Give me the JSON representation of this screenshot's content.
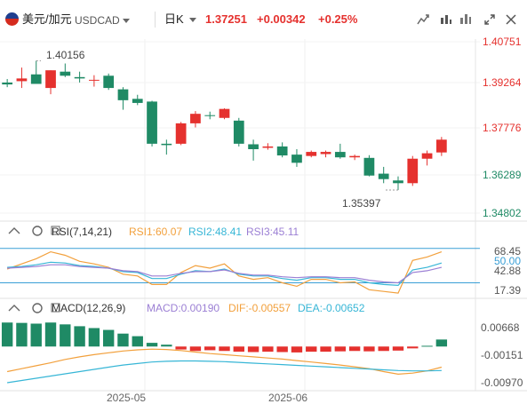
{
  "toolbar": {
    "pair_label": "美元/加元",
    "symbol": "USDCAD",
    "period": "日K",
    "last_price": "1.37251",
    "change": "+0.00342",
    "change_pct": "+0.25%",
    "icons": [
      "flag-us-icon",
      "chevron-down-icon",
      "chevron-down-icon",
      "candle-style-icon",
      "indicator-icon",
      "settings-icon",
      "fullscreen-icon",
      "close-icon"
    ]
  },
  "colors": {
    "up": "#e5312e",
    "down": "#1f8a65",
    "rsi1": "#f2a03c",
    "rsi2": "#37b6d6",
    "rsi3": "#9b7fd4",
    "diff": "#f2a03c",
    "dea": "#37b6d6"
  },
  "chart_data": [
    {
      "type": "candlestick",
      "panel": "price",
      "price_axis_ticks": [
        "1.40751",
        "1.39264",
        "1.37776",
        "1.36289",
        "1.34802"
      ],
      "ylim": [
        1.3455,
        1.4085
      ],
      "high_label": "1.40156",
      "low_label": "1.35397",
      "x_labels": [
        "2025-05",
        "2025-06"
      ],
      "candles": [
        {
          "o": 1.3935,
          "h": 1.3948,
          "l": 1.3918,
          "c": 1.3928
        },
        {
          "o": 1.394,
          "h": 1.399,
          "l": 1.3915,
          "c": 1.395
        },
        {
          "o": 1.3965,
          "h": 1.4015,
          "l": 1.395,
          "c": 1.393
        },
        {
          "o": 1.3915,
          "h": 1.398,
          "l": 1.3892,
          "c": 1.398
        },
        {
          "o": 1.3975,
          "h": 1.4005,
          "l": 1.3955,
          "c": 1.396
        },
        {
          "o": 1.3955,
          "h": 1.3975,
          "l": 1.3935,
          "c": 1.395
        },
        {
          "o": 1.3945,
          "h": 1.3962,
          "l": 1.392,
          "c": 1.3945
        },
        {
          "o": 1.396,
          "h": 1.3968,
          "l": 1.3908,
          "c": 1.3915
        },
        {
          "o": 1.391,
          "h": 1.3918,
          "l": 1.3835,
          "c": 1.387
        },
        {
          "o": 1.3875,
          "h": 1.389,
          "l": 1.3852,
          "c": 1.386
        },
        {
          "o": 1.3865,
          "h": 1.3868,
          "l": 1.37,
          "c": 1.371
        },
        {
          "o": 1.371,
          "h": 1.3725,
          "l": 1.367,
          "c": 1.3705
        },
        {
          "o": 1.371,
          "h": 1.379,
          "l": 1.3705,
          "c": 1.3785
        },
        {
          "o": 1.3785,
          "h": 1.383,
          "l": 1.377,
          "c": 1.382
        },
        {
          "o": 1.3815,
          "h": 1.3828,
          "l": 1.38,
          "c": 1.3812
        },
        {
          "o": 1.3805,
          "h": 1.384,
          "l": 1.38,
          "c": 1.3838
        },
        {
          "o": 1.3795,
          "h": 1.3805,
          "l": 1.37,
          "c": 1.371
        },
        {
          "o": 1.3708,
          "h": 1.3725,
          "l": 1.3648,
          "c": 1.369
        },
        {
          "o": 1.3695,
          "h": 1.3712,
          "l": 1.3688,
          "c": 1.37
        },
        {
          "o": 1.37,
          "h": 1.3715,
          "l": 1.366,
          "c": 1.3667
        },
        {
          "o": 1.367,
          "h": 1.369,
          "l": 1.3625,
          "c": 1.364
        },
        {
          "o": 1.3665,
          "h": 1.3685,
          "l": 1.366,
          "c": 1.368
        },
        {
          "o": 1.3672,
          "h": 1.3685,
          "l": 1.366,
          "c": 1.368
        },
        {
          "o": 1.368,
          "h": 1.371,
          "l": 1.3655,
          "c": 1.366
        },
        {
          "o": 1.366,
          "h": 1.367,
          "l": 1.365,
          "c": 1.3665
        },
        {
          "o": 1.3658,
          "h": 1.3668,
          "l": 1.359,
          "c": 1.3593
        },
        {
          "o": 1.36,
          "h": 1.3625,
          "l": 1.3565,
          "c": 1.358
        },
        {
          "o": 1.3575,
          "h": 1.359,
          "l": 1.354,
          "c": 1.3565
        },
        {
          "o": 1.3565,
          "h": 1.3665,
          "l": 1.3555,
          "c": 1.3655
        },
        {
          "o": 1.3655,
          "h": 1.3685,
          "l": 1.363,
          "c": 1.3675
        },
        {
          "o": 1.3678,
          "h": 1.3735,
          "l": 1.3665,
          "c": 1.3725
        }
      ]
    },
    {
      "type": "line",
      "panel": "rsi",
      "indicator_label": "RSI(7,14,21)",
      "legend": {
        "rsi1": "RSI1:60.07",
        "rsi2": "RSI2:48.41",
        "rsi3": "RSI3:45.11"
      },
      "axis_ticks": [
        "68.45",
        "50.00",
        "42.88",
        "17.39"
      ],
      "ref_levels": {
        "high": "70.00",
        "low": "30.00"
      },
      "ylim": [
        14,
        78
      ],
      "series": [
        {
          "name": "RSI1",
          "color_key": "rsi1",
          "values": [
            46,
            52,
            58,
            66,
            62,
            55,
            52,
            48,
            40,
            38,
            28,
            28,
            42,
            50,
            47,
            52,
            38,
            34,
            36,
            30,
            26,
            34,
            34,
            30,
            31,
            22,
            20,
            18,
            56,
            60,
            66
          ]
        },
        {
          "name": "RSI2",
          "color_key": "rsi2",
          "values": [
            48,
            49,
            51,
            54,
            53,
            50,
            49,
            47,
            43,
            42,
            35,
            35,
            40,
            44,
            43,
            46,
            40,
            38,
            38,
            35,
            33,
            36,
            36,
            34,
            34,
            30,
            28,
            27,
            45,
            48,
            53
          ]
        },
        {
          "name": "RSI3",
          "color_key": "rsi3",
          "values": [
            47,
            48,
            49,
            51,
            51,
            49,
            48,
            47,
            44,
            43,
            38,
            38,
            41,
            43,
            43,
            45,
            41,
            39,
            39,
            37,
            36,
            37,
            37,
            36,
            36,
            33,
            31,
            30,
            42,
            44,
            48
          ]
        }
      ]
    },
    {
      "type": "bar+line",
      "panel": "macd",
      "indicator_label": "MACD(12,26,9)",
      "legend": {
        "macd": "MACD:0.00190",
        "diff": "DIF:-0.00557",
        "dea": "DEA:-0.00652"
      },
      "axis_ticks": [
        "0.00668",
        "-0.00151",
        "-0.00970"
      ],
      "ylim": [
        -0.011,
        0.008
      ],
      "macd": [
        0.0065,
        0.0064,
        0.0062,
        0.0065,
        0.006,
        0.0055,
        0.005,
        0.0045,
        0.0035,
        0.0028,
        0.001,
        0.0005,
        -0.0008,
        -0.0012,
        -0.001,
        -0.0012,
        -0.0014,
        -0.0015,
        -0.0014,
        -0.0015,
        -0.0016,
        -0.0014,
        -0.0014,
        -0.0013,
        -0.0012,
        -0.0013,
        -0.0012,
        -0.0011,
        -0.0005,
        0.0002,
        0.0019
      ],
      "dif": [
        -0.0068,
        -0.006,
        -0.0052,
        -0.0044,
        -0.0035,
        -0.0028,
        -0.0022,
        -0.0017,
        -0.0012,
        -0.0009,
        -0.0007,
        -0.0008,
        -0.0011,
        -0.0015,
        -0.0019,
        -0.0022,
        -0.0025,
        -0.0028,
        -0.0031,
        -0.0034,
        -0.0038,
        -0.0042,
        -0.0046,
        -0.005,
        -0.0055,
        -0.006,
        -0.0068,
        -0.0075,
        -0.0072,
        -0.0066,
        -0.0056
      ],
      "dea": [
        -0.0098,
        -0.0092,
        -0.0086,
        -0.008,
        -0.0074,
        -0.0068,
        -0.0062,
        -0.0056,
        -0.005,
        -0.0046,
        -0.0042,
        -0.004,
        -0.0039,
        -0.0039,
        -0.004,
        -0.0041,
        -0.0043,
        -0.0045,
        -0.0047,
        -0.0049,
        -0.0051,
        -0.0053,
        -0.0055,
        -0.0057,
        -0.0059,
        -0.0061,
        -0.0063,
        -0.0065,
        -0.0066,
        -0.0066,
        -0.0065
      ]
    }
  ]
}
